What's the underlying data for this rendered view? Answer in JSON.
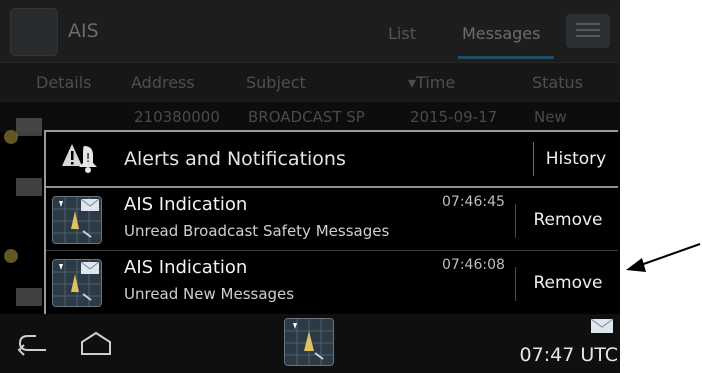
{
  "app": {
    "title": "AIS"
  },
  "tabs": [
    {
      "label": "List"
    },
    {
      "label": "Messages"
    }
  ],
  "columns": [
    {
      "label": "Details"
    },
    {
      "label": "Address"
    },
    {
      "label": "Subject"
    },
    {
      "label": "▾Time"
    },
    {
      "label": "Status"
    }
  ],
  "background_rows": [
    {
      "address": "210380000",
      "subject": "BROADCAST SP",
      "time": "2015-09-17",
      "status": "New"
    }
  ],
  "panel": {
    "title": "Alerts and Notifications",
    "history_label": "History",
    "notifications": [
      {
        "title": "AIS Indication",
        "subtitle": "Unread Broadcast Safety Messages",
        "time": "07:46:45",
        "remove_label": "Remove"
      },
      {
        "title": "AIS Indication",
        "subtitle": "Unread New Messages",
        "time": "07:46:08",
        "remove_label": "Remove"
      }
    ]
  },
  "status_bar": {
    "clock": "07:47 UTC"
  },
  "icons": {
    "app": "ais-radar-icon",
    "alert": "alert-bell-icon",
    "notification": "ais-radar-icon",
    "envelope": "envelope-icon",
    "back": "back-icon",
    "home": "home-icon"
  },
  "colors": {
    "panel_border": "#9a9a9a",
    "background": "#000000",
    "tab_accent": "#1f4d63"
  }
}
